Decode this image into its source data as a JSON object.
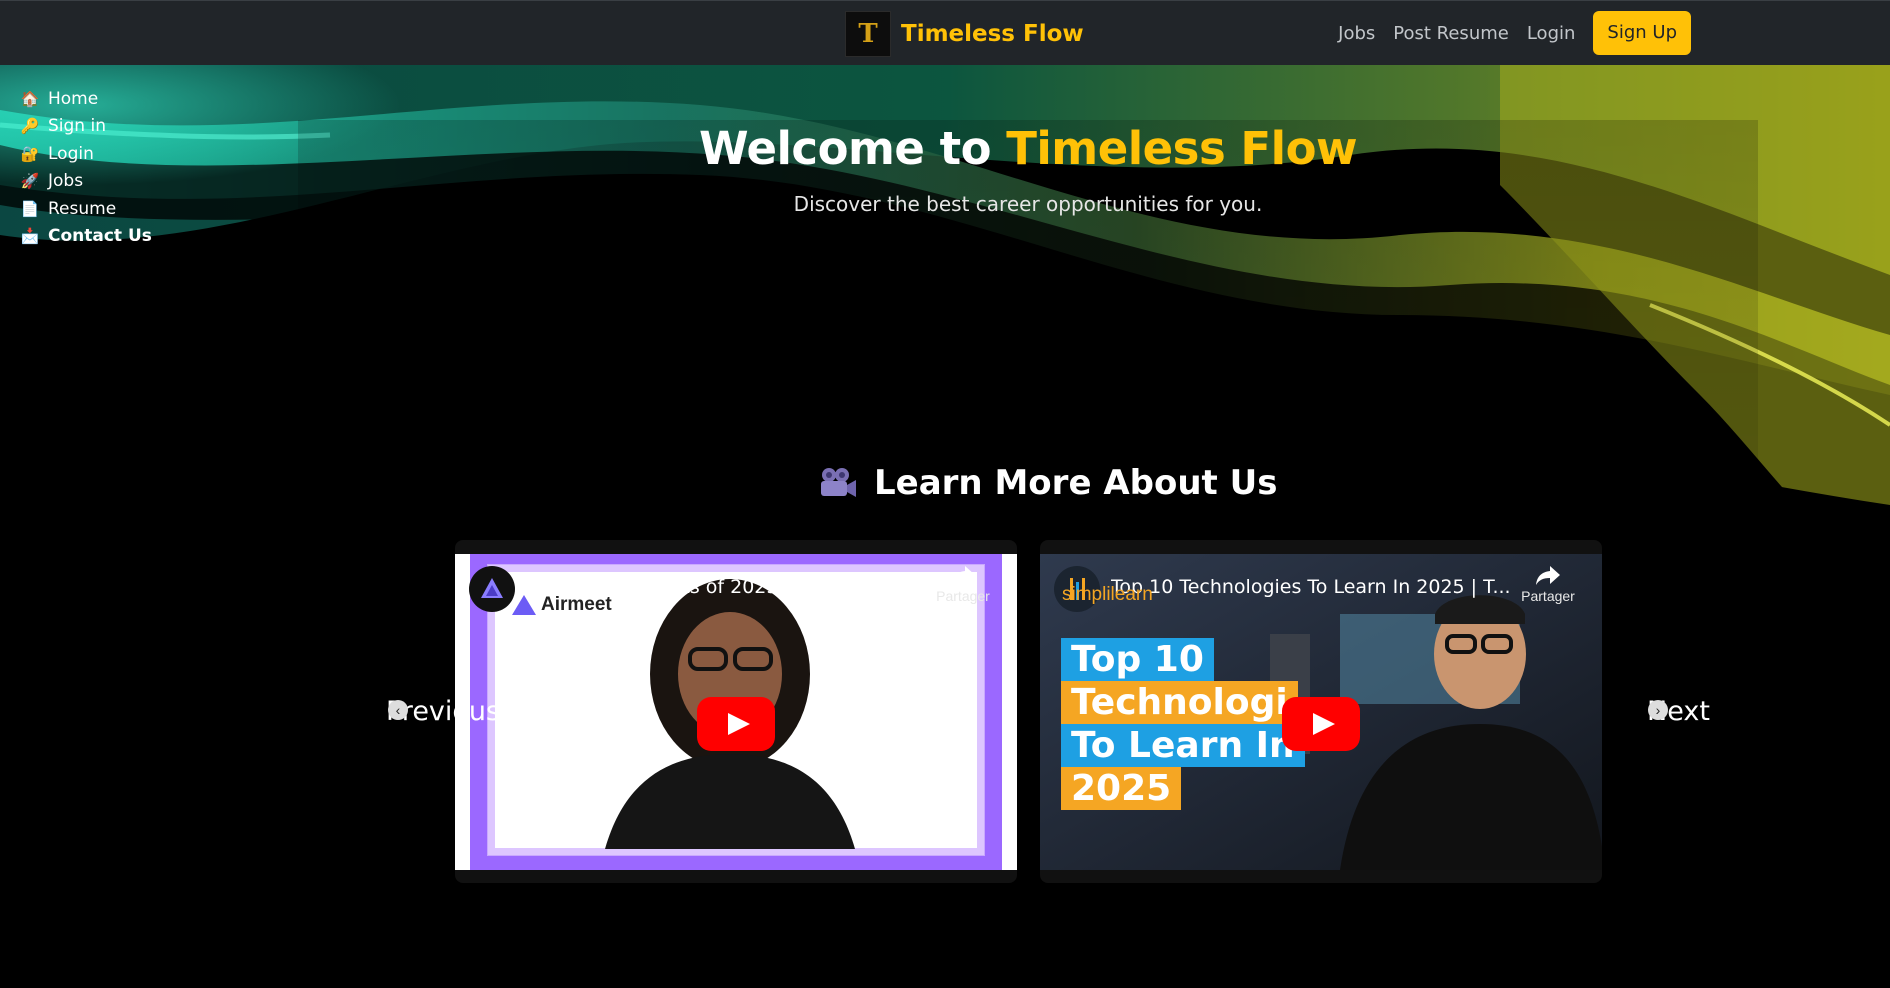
{
  "navbar": {
    "brand_name": "Timeless Flow",
    "logo_glyph": "T",
    "links": [
      "Jobs",
      "Post Resume",
      "Login"
    ],
    "signup_label": "Sign Up"
  },
  "side_menu": {
    "items": [
      {
        "label": "Home",
        "icon": "house-icon",
        "glyph": "🏠"
      },
      {
        "label": "Sign in",
        "icon": "key-icon",
        "glyph": "🔑"
      },
      {
        "label": "Login",
        "icon": "lock-icon",
        "glyph": "🔐"
      },
      {
        "label": "Jobs",
        "icon": "rocket-icon",
        "glyph": "🚀"
      },
      {
        "label": "Resume",
        "icon": "document-icon",
        "glyph": "📄"
      },
      {
        "label": "Contact Us",
        "icon": "envelope-icon",
        "glyph": "📩"
      }
    ]
  },
  "hero": {
    "title_prefix": "Welcome to ",
    "title_accent": "Timeless Flow",
    "subtitle": "Discover the best career opportunities for you."
  },
  "learn": {
    "heading": "Learn More About Us",
    "videos": [
      {
        "title": "Major Tech Events of 2025 | Virtual Event...",
        "channel_brand": "Airmeet",
        "share_label": "Partager"
      },
      {
        "title": "Top 10 Technologies To Learn In 2025 | T...",
        "channel_brand": "simplilearn",
        "share_label": "Partager",
        "thumb_lines": [
          "Top 10",
          "Technologi",
          "To Learn In",
          "2025"
        ]
      }
    ],
    "prev_label": "Previous",
    "next_label": "Next"
  },
  "colors": {
    "accent": "#ffc107",
    "navbar_bg": "#212529",
    "youtube_red": "#ff0000"
  }
}
